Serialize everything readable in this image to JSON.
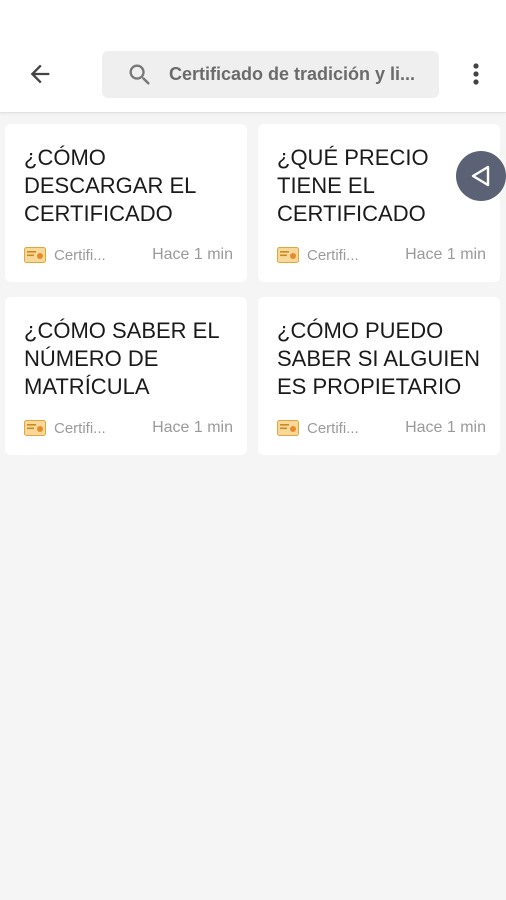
{
  "search": {
    "value": "Certificado de tradición y li..."
  },
  "cards": [
    {
      "title": "¿CÓMO DESCARGAR EL CERTIFICADO",
      "source": "Certifi...",
      "time": "Hace 1 min"
    },
    {
      "title": "¿QUÉ PRECIO TIENE EL CERTIFICADO",
      "source": "Certifi...",
      "time": "Hace 1 min"
    },
    {
      "title": "¿CÓMO SABER EL NÚMERO DE MATRÍCULA",
      "source": "Certifi...",
      "time": "Hace 1 min"
    },
    {
      "title": "¿CÓMO PUEDO SABER SI ALGUIEN ES PROPIETARIO",
      "source": "Certifi...",
      "time": "Hace 1 min"
    }
  ],
  "icons": {
    "back": "arrow-left-icon",
    "search": "search-icon",
    "more": "more-vertical-icon",
    "certificate": "certificate-icon",
    "floating": "triangle-left-icon"
  },
  "colors": {
    "background": "#f5f5f5",
    "header": "#ffffff",
    "search_bg": "#efefef",
    "float_button": "#5c6275",
    "certificate_icon": "#f0b94c"
  }
}
